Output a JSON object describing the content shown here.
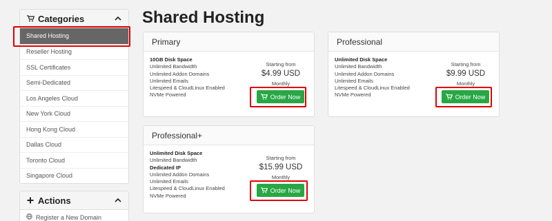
{
  "sidebar": {
    "categories": {
      "title": "Categories",
      "items": [
        {
          "label": "Shared Hosting"
        },
        {
          "label": "Reseller Hosting"
        },
        {
          "label": "SSL Certificates"
        },
        {
          "label": "Semi-Dedicated"
        },
        {
          "label": "Los Angeles Cloud"
        },
        {
          "label": "New York Cloud"
        },
        {
          "label": "Hong Kong Cloud"
        },
        {
          "label": "Dallas Cloud"
        },
        {
          "label": "Toronto Cloud"
        },
        {
          "label": "Singapore Cloud"
        }
      ]
    },
    "actions": {
      "title": "Actions",
      "items": [
        {
          "label": "Register a New Domain"
        }
      ]
    }
  },
  "main": {
    "title": "Shared Hosting",
    "products": [
      {
        "name": "Primary",
        "features": [
          {
            "text": "10GB Disk Space",
            "bold": true
          },
          {
            "text": "Unlimited Bandwidth"
          },
          {
            "text": "Unlimited Addon Domains"
          },
          {
            "text": "Unlimited Emails"
          },
          {
            "text": "Litespeed & CloudLinux Enabled"
          },
          {
            "text": "NVMe Powered"
          }
        ],
        "starting_label": "Starting from",
        "price": "$4.99 USD",
        "cycle": "Monthly",
        "button": "Order Now"
      },
      {
        "name": "Professional",
        "features": [
          {
            "text": "Unlimited Disk Space",
            "bold": true
          },
          {
            "text": "Unlimited Bandwidth"
          },
          {
            "text": "Unlimited Addon Domains"
          },
          {
            "text": "Unlimited Emails"
          },
          {
            "text": "Litespeed & CloudLinux Enabled"
          },
          {
            "text": "NVMe Powered"
          }
        ],
        "starting_label": "Starting from",
        "price": "$9.99 USD",
        "cycle": "Monthly",
        "button": "Order Now"
      },
      {
        "name": "Professional+",
        "features": [
          {
            "text": "Unlimited Disk Space",
            "bold": true
          },
          {
            "text": "Unlimited Bandwidth"
          },
          {
            "text": "Dedicated IP",
            "bold": true
          },
          {
            "text": "Unlimited Addon Domains"
          },
          {
            "text": "Unlimited Emails"
          },
          {
            "text": "Litespeed & CloudLinux Enabled"
          },
          {
            "text": "NVMe Powered"
          }
        ],
        "starting_label": "Starting from",
        "price": "$15.99 USD",
        "cycle": "Monthly",
        "button": "Order Now"
      }
    ]
  },
  "colors": {
    "order_button": "#28a745",
    "active_category": "#666666",
    "highlight": "#e00000"
  },
  "icons": [
    "cart-icon",
    "chevron-up-icon",
    "plus-icon",
    "globe-icon"
  ]
}
